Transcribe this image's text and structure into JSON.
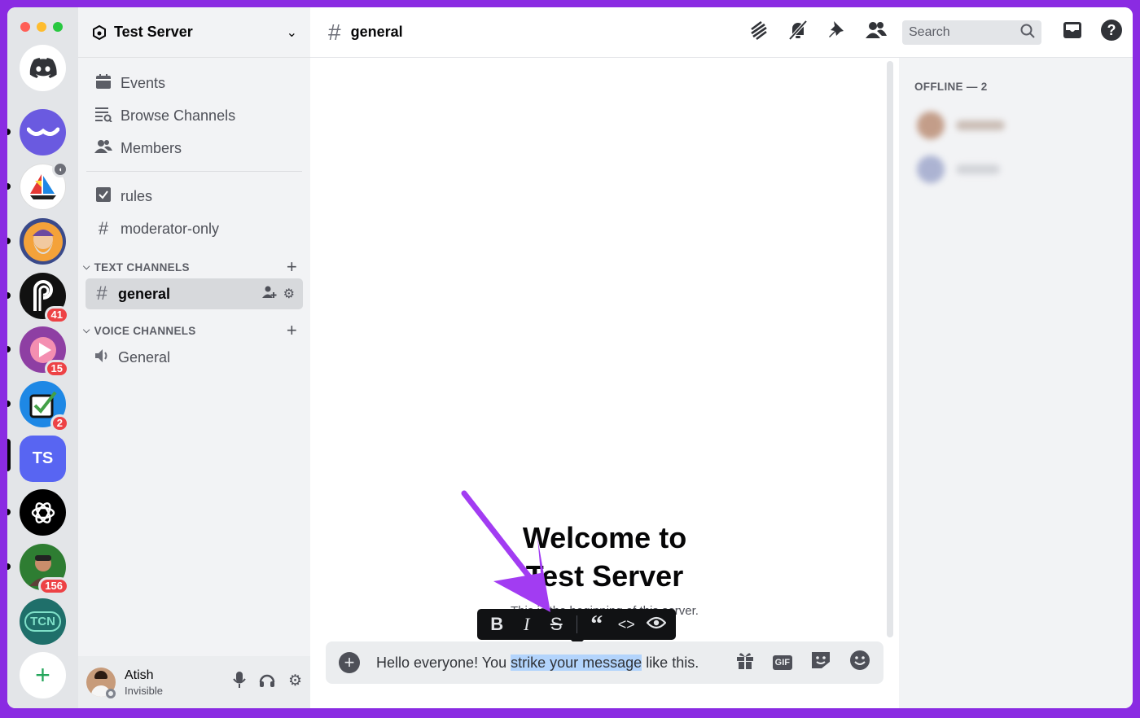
{
  "window": {
    "traffic_lights": [
      "#ff5f57",
      "#febc2e",
      "#28c840"
    ]
  },
  "rail": {
    "servers": [
      {
        "name": "discord-home",
        "color": "#ffffff",
        "icon": "discord-icon"
      },
      {
        "name": "wave-server",
        "color": "#6a5ae0",
        "icon": "wave-icon"
      },
      {
        "name": "boat-server",
        "color": "#ffffff",
        "icon": "sailboat-icon"
      },
      {
        "name": "wizard-server",
        "color": "#3a4a8a",
        "icon": "wizard-icon",
        "badge": ""
      },
      {
        "name": "p-server",
        "color": "#111111",
        "icon": "p-logo-icon",
        "badge": "41"
      },
      {
        "name": "play-server",
        "color": "#8e3fa3",
        "icon": "play-icon",
        "badge": "15"
      },
      {
        "name": "check-server",
        "color": "#1e88e5",
        "icon": "checkbox-icon",
        "badge": "2"
      },
      {
        "name": "ts-server",
        "color": "#5865f2",
        "label": "TS"
      },
      {
        "name": "openai-server",
        "color": "#000000",
        "icon": "openai-icon"
      },
      {
        "name": "person-server",
        "color": "#2e7d32",
        "icon": "person-icon",
        "badge": "156"
      },
      {
        "name": "tcn-server",
        "color": "#1f6f6a",
        "label": "TCN"
      }
    ],
    "add_label": "+"
  },
  "sidebar": {
    "server_name": "Test Server",
    "nav": [
      {
        "label": "Events",
        "icon": "calendar-icon"
      },
      {
        "label": "Browse Channels",
        "icon": "browse-channels-icon"
      },
      {
        "label": "Members",
        "icon": "members-icon"
      }
    ],
    "top_channels": [
      {
        "label": "rules",
        "icon": "rules-icon"
      },
      {
        "label": "moderator-only",
        "icon": "locked-hash-icon"
      }
    ],
    "text_category": "TEXT CHANNELS",
    "text_channels": [
      {
        "label": "general"
      }
    ],
    "voice_category": "VOICE CHANNELS",
    "voice_channels": [
      {
        "label": "General"
      }
    ]
  },
  "user": {
    "name": "Atish",
    "status": "Invisible"
  },
  "header": {
    "channel": "general",
    "search_placeholder": "Search"
  },
  "welcome": {
    "line1": "Welcome to",
    "line2": "Test Server",
    "sub": "This is the beginning of this server."
  },
  "composer": {
    "before": "Hello everyone! You ",
    "selected": "strike your message",
    "after": " like this.",
    "gif_label": "GIF"
  },
  "format_toolbar": [
    "bold",
    "italic",
    "strikethrough",
    "quote",
    "code",
    "spoiler"
  ],
  "members": {
    "header": "OFFLINE — 2"
  },
  "colors": {
    "accent": "#5865f2",
    "arrow": "#a23cf2",
    "background": "#8a2be2"
  }
}
